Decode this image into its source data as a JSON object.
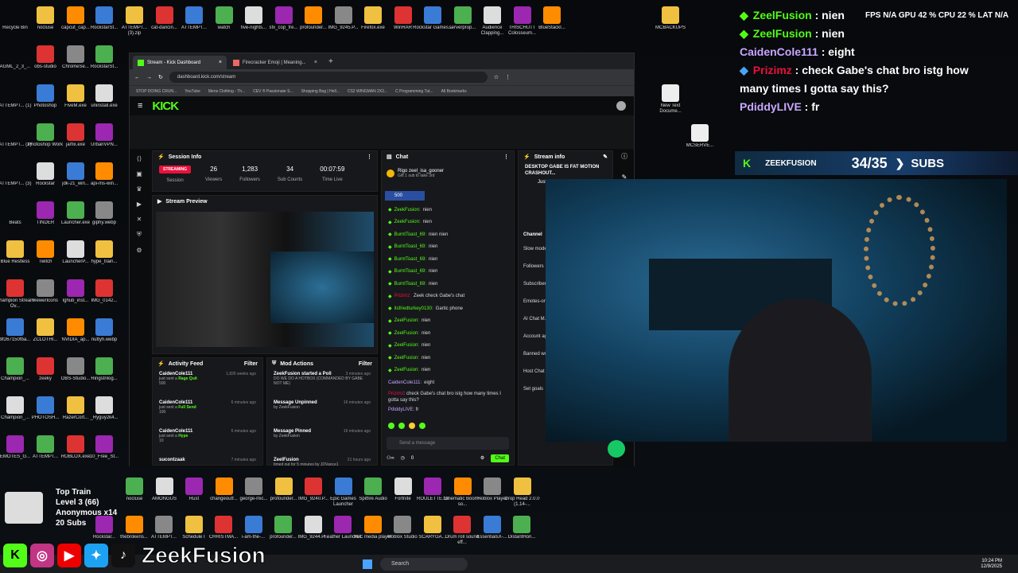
{
  "desktop": {
    "col1": [
      "Recycle Bin",
      "AGML_2_3_...",
      "ATTEMPT... (1)",
      "ATTEMPT... (2)",
      "ATTEMPT... (3)",
      "Beats",
      "Blue Restless",
      "Champion Stream Ov...",
      "9f267150fba...",
      "Champion_...",
      "Champion_...",
      "EMOTES_G..."
    ],
    "col2": [
      "nocluse",
      "obs-studio",
      "Photoshop",
      "Photoshop Work",
      "Rockstar",
      "TINDER",
      "Twitch",
      "viewerIcons",
      "ZCLOTHI...",
      "zeeky",
      "PHOTOSH...",
      "ATTEMPT..."
    ],
    "col3": [
      "capcut_cap...",
      "ChromeSe...",
      "FiveM.exe",
      "jarfix.exe",
      "jdk-21_win...",
      "Launcher.exe",
      "LauncherP...",
      "lghub_inst...",
      "NVIDIA_ap...",
      "OBS-Studio...",
      "RazerCort...",
      "ROBLOX.exe"
    ],
    "col4": [
      "RockstarSt...",
      "RockstarSt...",
      "uninstall.exe",
      "UrbanVPN...",
      "api-ms-win...",
      "giphy.webp",
      "hype_train...",
      "IMG_0142...",
      "nuttyh.webp",
      "Ringstrilog...",
      "_Ryguy2k4...",
      "10_Free_St..."
    ],
    "toprow": [
      "ATTEMPT... (3).zip",
      "cat-dancin...",
      "ATTEMPT...",
      "watch",
      "five-nights...",
      "sfx_cop_fre...",
      "profounder...",
      "IMG_9245.P...",
      "Firefox.exe",
      "WinRAR",
      "Rockstar Games...",
      "serverprop...",
      "Audience Clapping...",
      "THISCHUTT Colosseum...",
      "BlueStackI..."
    ],
    "right": [
      "MCBACKUPS",
      "New Text Docume...",
      "MCSERVE..."
    ],
    "bottomrow1": [
      "nocluse",
      "AMONGUS",
      "Rust",
      "changeoutf...",
      "george-mic...",
      "profounder...",
      "IMG_9240.P...",
      "Epic Games Launcher",
      "Spitfire Audio",
      "Fortnite",
      "ROULETTE.txt",
      "Cinematic Boom - so...",
      "Roblox Player",
      "Drop Head 2.0.0 (1.14-..."
    ],
    "bottomrow2": [
      "Rockstar...",
      "thebrokens...",
      "ATTEMPT...",
      "Schedule I",
      "CHRISTMA...",
      "i-am-the-...",
      "profounder...",
      "IMG_9244.P...",
      "Feather Launcher",
      "VLC media player",
      "Roblox Studio",
      "SCARYGA...",
      "Drum roll sound eff...",
      "EssentialsX-...",
      "DistantHori..."
    ]
  },
  "browser": {
    "tabs": [
      {
        "label": "Stream - Kick Dashboard"
      },
      {
        "label": "Firecracker Emoji | Meaning..."
      }
    ],
    "url": "dashboard.kick.com/stream",
    "bookmarks": [
      "STOP DOING CRUN...",
      "YouTube",
      "Mens Clothing - Th...",
      "CEV ® Passionate S...",
      "Shopping Bag | Holl...",
      "CS2 WINGMAN 2X2...",
      "C Programming Tut...",
      "All Bookmarks"
    ],
    "logo": "KICK"
  },
  "session": {
    "title": "Session Info",
    "status": "STREAMING",
    "status_label": "Session",
    "stats": [
      {
        "value": "26",
        "label": "Viewers"
      },
      {
        "value": "1,283",
        "label": "Followers"
      },
      {
        "value": "34",
        "label": "Sub Counts"
      },
      {
        "value": "00:07:59",
        "label": "Time Live"
      }
    ]
  },
  "preview": {
    "title": "Stream Preview"
  },
  "chat": {
    "title": "Chat",
    "pinned_user": "zeel_isa_gooner",
    "pinned_text": "Gift 1 sub to take 3rd",
    "pinned_name": "Rigo",
    "goal": "500",
    "lines": [
      {
        "user": "ZeekFusion",
        "text": "nien",
        "color": "green"
      },
      {
        "user": "ZeekFusion",
        "text": "nien",
        "color": "green"
      },
      {
        "user": "BurntToast_69",
        "text": "nien nien",
        "color": "green"
      },
      {
        "user": "BurntToast_69",
        "text": "nien",
        "color": "green"
      },
      {
        "user": "BurntToast_69",
        "text": "nien",
        "color": "green"
      },
      {
        "user": "BurntToast_69",
        "text": "nien",
        "color": "green"
      },
      {
        "user": "BurntToast_69",
        "text": "nien",
        "color": "green"
      },
      {
        "user": "Prizimz",
        "text": "Zeek check Gabe's chat",
        "color": "red"
      },
      {
        "user": "itsfriedturkey0130",
        "text": "Gartic phone",
        "color": "green"
      },
      {
        "user": "ZeelFusion",
        "text": "nien",
        "color": "green"
      },
      {
        "user": "ZeelFusion",
        "text": "nien",
        "color": "green"
      },
      {
        "user": "ZeelFusion",
        "text": "nien",
        "color": "green"
      },
      {
        "user": "ZeelFusion",
        "text": "nien",
        "color": "green"
      },
      {
        "user": "ZeelFusion",
        "text": "nien",
        "color": "green"
      },
      {
        "user": "CaidenCole111",
        "text": "eight",
        "color": "purple"
      }
    ],
    "multiline_user": "Prizimz",
    "multiline_text": "check Gabe's chat bro istg how many times I gotta say this?",
    "last_user": "PdiddyLIVE",
    "last_text": "fr",
    "placeholder": "Send a message",
    "send_label": "Chat",
    "viewer_count": "0"
  },
  "streaminfo": {
    "title": "Stream info",
    "stream_title": "DESKTOP GABE IS FAT MOTION CRASHOUT...",
    "category": "Just Chatting",
    "channel_header": "Channel",
    "settings": [
      "Slow mode",
      "Followers",
      "Subscribers",
      "Emotes-only",
      "AI Chat M...",
      "Account age",
      "Banned words",
      "Host Chat",
      "Set goals"
    ]
  },
  "activity": {
    "title": "Activity Feed",
    "filter": "Filter",
    "items": [
      {
        "user": "CaidenCole111",
        "time": "1,826 weeks ago",
        "action": "just sent a",
        "item": "Rage Quit",
        "amount": "500"
      },
      {
        "user": "CaidenCole111",
        "time": "6 minutes ago",
        "action": "just sent a",
        "item": "Full Send",
        "amount": "100"
      },
      {
        "user": "CaidenCole111",
        "time": "6 minutes ago",
        "action": "just sent a",
        "item": "Hype",
        "amount": "10"
      },
      {
        "user": "sucontzaak",
        "time": "7 minutes ago",
        "action": "",
        "item": "",
        "amount": ""
      }
    ]
  },
  "mod": {
    "title": "Mod Actions",
    "filter": "Filter",
    "items": [
      {
        "title": "ZeekFusion started a Poll",
        "time": "3 minutes ago",
        "sub": "DO WE DO A HOTBOX (COMMANDED BY GABE NOT ME)"
      },
      {
        "title": "Message Unpinned",
        "time": "16 minutes ago",
        "sub": "by ZeekFusion"
      },
      {
        "title": "Message Pinned",
        "time": "16 minutes ago",
        "sub": "by ZeekFusion"
      },
      {
        "title": "ZeelFusion",
        "time": "21 hours ago",
        "sub": "timed out for 5 minutes by JDVance1"
      }
    ]
  },
  "overlay": {
    "chat": [
      {
        "user": "ZeelFusion",
        "text": "nien",
        "color": "green",
        "badge": "diamond"
      },
      {
        "user": "ZeelFusion",
        "text": "nien",
        "color": "green",
        "badge": "diamond"
      },
      {
        "user": "CaidenCole111",
        "text": "eight",
        "color": "purple",
        "badge": ""
      },
      {
        "user": "Prizimz",
        "text": "check Gabe's chat bro istg how many times I gotta say this?",
        "color": "red",
        "badge": "gift"
      },
      {
        "user": "PdiddyLIVE",
        "text": "fr",
        "color": "purple",
        "badge": ""
      }
    ],
    "hud": {
      "fps_label": "FPS",
      "fps": "N/A",
      "gpu_label": "GPU",
      "gpu": "42 %",
      "cpu_label": "CPU",
      "cpu": "22 %",
      "lat_label": "LAT",
      "lat": "N/A"
    },
    "subgoal": {
      "name": "ZEEKFUSION",
      "count": "34/35",
      "label": "SUBS"
    },
    "train": {
      "title": "Top Train",
      "level": "Level 3",
      "level_count": "(66)",
      "anon": "Anonymous x14",
      "subs": "20 Subs"
    },
    "handle": "ZeekFusion"
  },
  "taskbar": {
    "search": "Search",
    "time": "10:24 PM",
    "date": "12/9/2025"
  },
  "colors": {
    "kick_green": "#53fc18",
    "streaming_red": "#e9113c"
  }
}
